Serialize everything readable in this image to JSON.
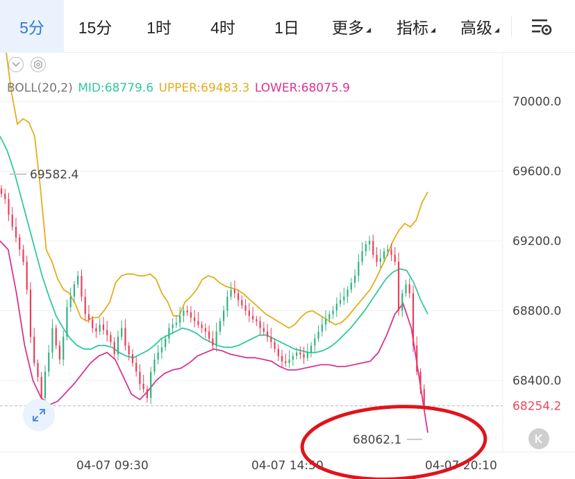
{
  "tabs": [
    {
      "label": "5分",
      "active": true
    },
    {
      "label": "15分",
      "active": false
    },
    {
      "label": "1时",
      "active": false
    },
    {
      "label": "4时",
      "active": false
    },
    {
      "label": "1日",
      "active": false
    },
    {
      "label": "更多",
      "active": false,
      "dropdown": true
    },
    {
      "label": "指标",
      "active": false,
      "dropdown": true
    },
    {
      "label": "高级",
      "active": false,
      "dropdown": true
    }
  ],
  "icons": {
    "settings": "chart-settings-icon",
    "collapse": "chevron-down-icon",
    "indicator_settings": "hexagon-gear-icon",
    "expand": "expand-arrows-icon",
    "back": "chevron-double-left-icon"
  },
  "legend": {
    "name": "BOLL(20,2)",
    "mid": "MID:68779.6",
    "upper": "UPPER:69483.3",
    "lower": "LOWER:68075.9"
  },
  "colors": {
    "accent": "#2d7bd8",
    "up": "#2fb37e",
    "down": "#ea3d5a",
    "mid": "#2ec9a0",
    "upper": "#e3ad1b",
    "lower": "#d9348f",
    "last_price": "#e7485f",
    "annotation_ring": "#e0141b"
  },
  "chart_data": {
    "type": "candlestick",
    "y_ticks": [
      "70000.0",
      "69600.0",
      "69200.0",
      "68800.0",
      "68400.0"
    ],
    "y_tick_values": [
      70000,
      69600,
      69200,
      68800,
      68400
    ],
    "x_ticks": [
      "04-07 09:30",
      "04-07 14:50",
      "04-07 20:10"
    ],
    "x_tick_index": [
      24,
      88,
      152
    ],
    "last_price": "68254.2",
    "last_price_value": 68254.2,
    "max_label": "69582.4",
    "max_value": 69582.4,
    "min_label": "68062.1",
    "min_value": 68062.1,
    "ylim": [
      67980,
      70500
    ],
    "bar_count": 157,
    "closes": [
      69470,
      69440,
      69350,
      69280,
      69220,
      69150,
      69080,
      68920,
      68650,
      68500,
      68420,
      68300,
      68450,
      68560,
      68700,
      68600,
      68520,
      68650,
      68820,
      68880,
      68950,
      69000,
      68880,
      68780,
      68750,
      68700,
      68680,
      68720,
      68690,
      68660,
      68620,
      68550,
      68650,
      68700,
      68600,
      68550,
      68500,
      68450,
      68380,
      68350,
      68300,
      68450,
      68520,
      68560,
      68590,
      68640,
      68700,
      68720,
      68730,
      68770,
      68800,
      68790,
      68760,
      68740,
      68720,
      68700,
      68680,
      68640,
      68600,
      68680,
      68740,
      68800,
      68880,
      68920,
      68900,
      68860,
      68830,
      68800,
      68770,
      68750,
      68740,
      68700,
      68680,
      68650,
      68620,
      68580,
      68540,
      68510,
      68500,
      68520,
      68540,
      68560,
      68550,
      68530,
      68560,
      68600,
      68640,
      68680,
      68720,
      68750,
      68780,
      68800,
      68840,
      68860,
      68880,
      68920,
      68960,
      69000,
      69080,
      69140,
      69180,
      69200,
      69120,
      69080,
      69100,
      69140,
      69150,
      69120,
      69080,
      68800,
      68900,
      68950,
      68900,
      68600,
      68450,
      68350,
      68254.2
    ],
    "bands": {
      "upper": [
        70400,
        70300,
        70050,
        69870,
        69900,
        69880,
        69800,
        69500,
        69150,
        69080,
        68980,
        68920,
        68900,
        68840,
        68760,
        68740,
        68760,
        68760,
        68800,
        68850,
        68960,
        69000,
        69010,
        69010,
        69000,
        69000,
        69010,
        68980,
        68900,
        68850,
        68770,
        68770,
        68850,
        68880,
        68920,
        68980,
        69000,
        68990,
        68960,
        68940,
        68930,
        68920,
        68900,
        68870,
        68840,
        68810,
        68780,
        68760,
        68740,
        68720,
        68700,
        68720,
        68760,
        68790,
        68800,
        68780,
        68760,
        68740,
        68720,
        68730,
        68760,
        68800,
        68840,
        68880,
        68920,
        68980,
        69050,
        69120,
        69200,
        69260,
        69300,
        69280,
        69320,
        69420,
        69480
      ],
      "mid": [
        69800,
        69720,
        69600,
        69450,
        69300,
        69150,
        69000,
        68880,
        68770,
        68700,
        68640,
        68600,
        68580,
        68580,
        68600,
        68600,
        68590,
        68560,
        68540,
        68530,
        68550,
        68570,
        68600,
        68640,
        68660,
        68680,
        68700,
        68690,
        68670,
        68640,
        68620,
        68600,
        68590,
        68590,
        68600,
        68620,
        68640,
        68660,
        68660,
        68640,
        68620,
        68600,
        68580,
        68570,
        68560,
        68560,
        68570,
        68590,
        68620,
        68660,
        68700,
        68750,
        68800,
        68860,
        68920,
        68980,
        69020,
        69040,
        69030,
        68960,
        68860,
        68780
      ],
      "lower": [
        69200,
        69150,
        68900,
        68600,
        68400,
        68300,
        68260,
        68280,
        68330,
        68380,
        68440,
        68500,
        68540,
        68560,
        68520,
        68420,
        68320,
        68290,
        68340,
        68400,
        68440,
        68460,
        68470,
        68500,
        68540,
        68560,
        68580,
        68570,
        68550,
        68540,
        68530,
        68530,
        68520,
        68510,
        68480,
        68460,
        68460,
        68470,
        68480,
        68490,
        68490,
        68480,
        68480,
        68490,
        68500,
        68510,
        68560,
        68660,
        68780,
        68840,
        68700,
        68400,
        68100
      ]
    }
  }
}
